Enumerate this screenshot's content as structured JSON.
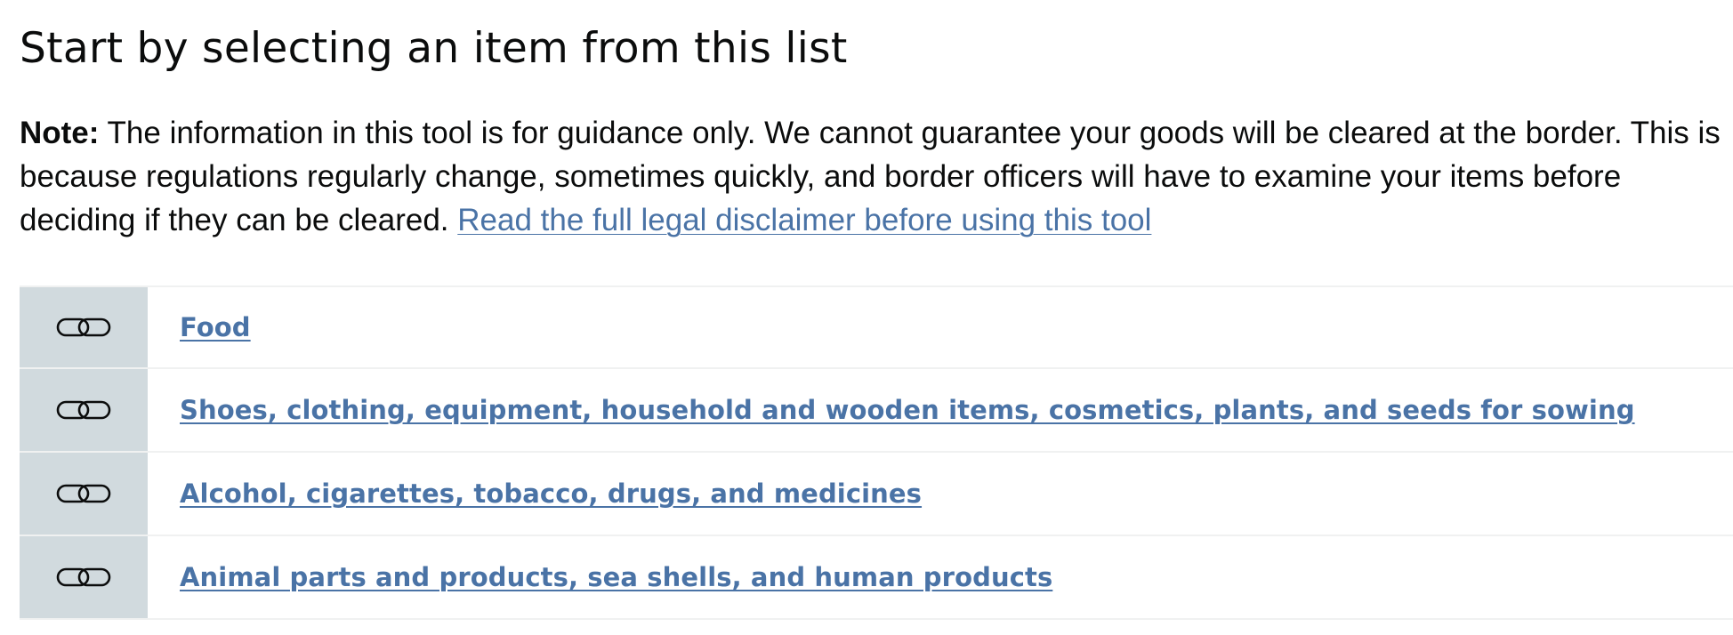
{
  "heading": "Start by selecting an item from this list",
  "note": {
    "label": "Note:",
    "text": " The information in this tool is for guidance only. We cannot guarantee your goods will be cleared at the border. This is because regulations regularly change, sometimes quickly, and border officers will have to examine your items before deciding if they can be cleared. ",
    "link_text": "Read the full legal disclaimer before using this tool"
  },
  "items": [
    {
      "label": "Food",
      "icon": "link-icon"
    },
    {
      "label": "Shoes, clothing, equipment, household and wooden items, cosmetics, plants, and seeds for sowing",
      "icon": "link-icon"
    },
    {
      "label": "Alcohol, cigarettes, tobacco, drugs, and medicines",
      "icon": "link-icon"
    },
    {
      "label": "Animal parts and products, sea shells, and human products",
      "icon": "link-icon"
    }
  ],
  "colors": {
    "link": "#4a73a6",
    "icon_cell_bg": "#d1dade",
    "text": "#0b0c0c",
    "divider": "#f0f1f1"
  }
}
